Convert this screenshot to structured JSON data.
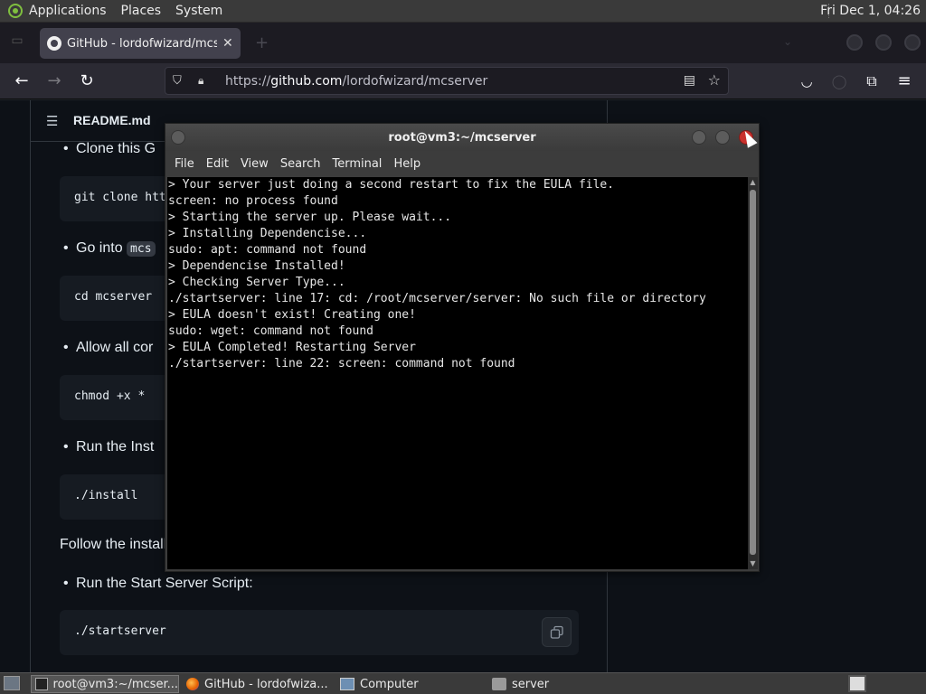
{
  "top_panel": {
    "menus": [
      "Applications",
      "Places",
      "System"
    ],
    "clock": "Fri Dec 1, 04:26"
  },
  "browser": {
    "tab_title": "GitHub - lordofwizard/mcserver",
    "url_host": "github.com",
    "url_scheme": "https://",
    "url_path": "/lordofwizard/mcserver"
  },
  "readme": {
    "title": "README.md",
    "items": {
      "clone": "Clone this G",
      "clone_code": "git clone htt",
      "go_into": "Go into",
      "go_into_code": "mcs",
      "cd_code": "cd mcserver",
      "allow": "Allow all cor",
      "chmod_code": "chmod +x *",
      "run_install": "Run the Inst",
      "install_code": "./install",
      "follow": "Follow the install",
      "run_start": "Run the Start Server Script:",
      "start_code": "./startserver"
    }
  },
  "terminal": {
    "title": "root@vm3:~/mcserver",
    "menus": [
      "File",
      "Edit",
      "View",
      "Search",
      "Terminal",
      "Help"
    ],
    "lines": [
      "> Your server just doing a second restart to fix the EULA file.",
      "screen: no process found",
      "> Starting the server up. Please wait...",
      "> Installing Dependencise...",
      "sudo: apt: command not found",
      "> Dependencise Installed!",
      "> Checking Server Type...",
      "./startserver: line 17: cd: /root/mcserver/server: No such file or directory",
      "> EULA doesn't exist! Creating one!",
      "sudo: wget: command not found",
      "> EULA Completed! Restarting Server",
      "./startserver: line 22: screen: command not found"
    ]
  },
  "taskbar": {
    "items": [
      {
        "label": "root@vm3:~/mcser...",
        "icon": "terminal-icon"
      },
      {
        "label": "GitHub - lordofwiza...",
        "icon": "firefox-icon"
      },
      {
        "label": "Computer",
        "icon": "computer-icon"
      },
      {
        "label": "server",
        "icon": "folder-icon"
      }
    ]
  }
}
